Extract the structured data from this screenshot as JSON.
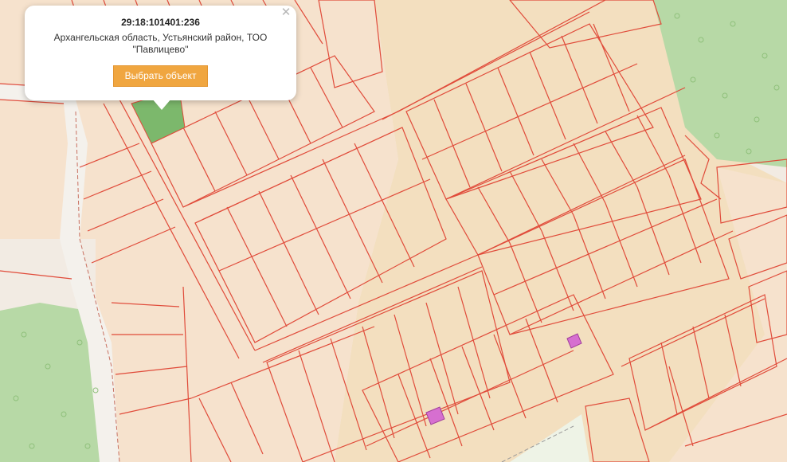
{
  "popup": {
    "cadastral_number": "29:18:101401:236",
    "address_line1": "Архангельская область, Устьянский район, ТОО",
    "address_line2": "\"Павлицево\"",
    "select_button": "Выбрать объект",
    "close_icon": "close-icon"
  },
  "colors": {
    "base": "#f2ebe3",
    "parcel_fill": "#f6e2cd",
    "settlement_fill": "#f3dfbf",
    "forest": "#b7d9a6",
    "road": "#f4f1ec",
    "boundary": "#e04b3a",
    "selected_parcel": "#7cb86c",
    "building": "#d66fd0",
    "button": "#f0a640"
  }
}
